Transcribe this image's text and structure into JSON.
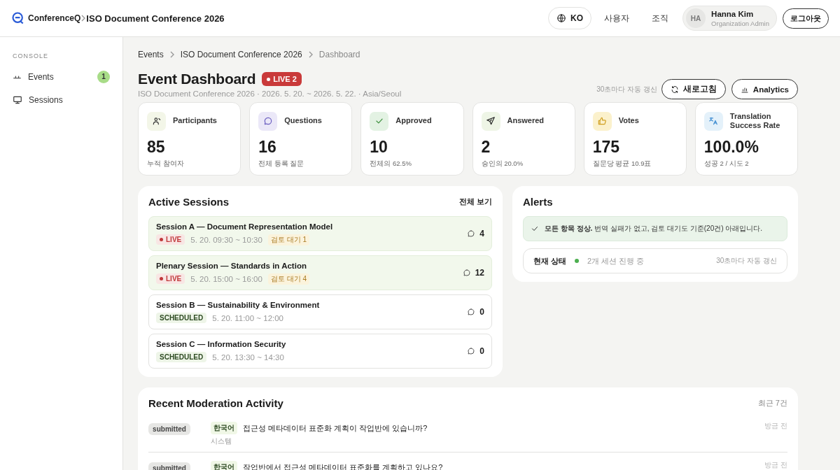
{
  "header": {
    "logo": "ConferenceQ",
    "title": "ISO Document Conference 2026",
    "language": "KO",
    "nav": [
      "사용자",
      "조직"
    ],
    "user": {
      "initials": "HA",
      "name": "Hanna Kim",
      "role": "Organization Admin"
    },
    "logout": "로그아웃"
  },
  "sidebar": {
    "section": "CONSOLE",
    "items": [
      {
        "label": "Events",
        "kind": "events",
        "badge": "1",
        "selected": false
      },
      {
        "label": "Sessions",
        "kind": "monitor",
        "selected": false
      }
    ]
  },
  "breadcrumb": [
    "Events",
    "ISO Document Conference 2026",
    "Dashboard"
  ],
  "page": {
    "title": "Event Dashboard",
    "live_badge": "LIVE 2",
    "subtitle": "ISO Document Conference 2026 · 2026. 5. 20. ~ 2026. 5. 22. · Asia/Seoul",
    "auto_refresh": "30초마다 자동 갱신",
    "refresh_button": "새로고침",
    "analytics_button": "Analytics"
  },
  "stats": [
    {
      "kind": "participants",
      "label": "Participants",
      "value": "85",
      "note": "누적 참여자"
    },
    {
      "kind": "questions",
      "label": "Questions",
      "value": "16",
      "note": "전체 등록 질문"
    },
    {
      "kind": "approved",
      "label": "Approved",
      "value": "10",
      "note": "전체의 62.5%"
    },
    {
      "kind": "answered",
      "label": "Answered",
      "value": "2",
      "note": "승인의 20.0%"
    },
    {
      "kind": "votes",
      "label": "Votes",
      "value": "175",
      "note": "질문당 평균 10.9표"
    },
    {
      "kind": "translation",
      "label": "Translation Success Rate",
      "value": "100.0%",
      "note": "성공 2 / 시도 2"
    }
  ],
  "active_sessions": {
    "title": "Active Sessions",
    "link": "전체 보기",
    "sessions": [
      {
        "title": "Session A — Document Representation Model",
        "kind": "live",
        "status_label": "LIVE",
        "time": "5. 20. 09:30 ~ 10:30",
        "pending": "검토 대기 1",
        "count": "4"
      },
      {
        "title": "Plenary Session — Standards in Action",
        "kind": "live",
        "status_label": "LIVE",
        "time": "5. 20. 15:00 ~ 16:00",
        "pending": "검토 대기 4",
        "count": "12"
      },
      {
        "title": "Session B — Sustainability & Environment",
        "kind": "scheduled",
        "status_label": "SCHEDULED",
        "time": "5. 20. 11:00 ~ 12:00",
        "count": "0"
      },
      {
        "title": "Session C — Information Security",
        "kind": "scheduled",
        "status_label": "SCHEDULED",
        "time": "5. 20. 13:30 ~ 14:30",
        "count": "0"
      }
    ]
  },
  "alerts": {
    "title": "Alerts",
    "message": "**모든 항목 정상.** 번역 실패가 없고, 검토 대기도 기준(20건) 아래입니다.",
    "status": {
      "label": "현재 상태",
      "color": "#4caf50",
      "text": "2개 세션 진행 중",
      "note": "30초마다 자동 갱신"
    }
  },
  "activity": {
    "title": "Recent Moderation Activity",
    "count": "최근 7건",
    "rows": [
      {
        "status": "submitted",
        "language": "한국어",
        "question": "접근성 메타데이터 표준화 계획이 작업반에 있습니까?",
        "author": "시스템",
        "time": "방금 전"
      },
      {
        "status": "submitted",
        "language": "한국어",
        "question": "작업반에서 접근성 메타데이터 표준화를 계획하고 있나요?",
        "time": "방금 전"
      }
    ]
  }
}
